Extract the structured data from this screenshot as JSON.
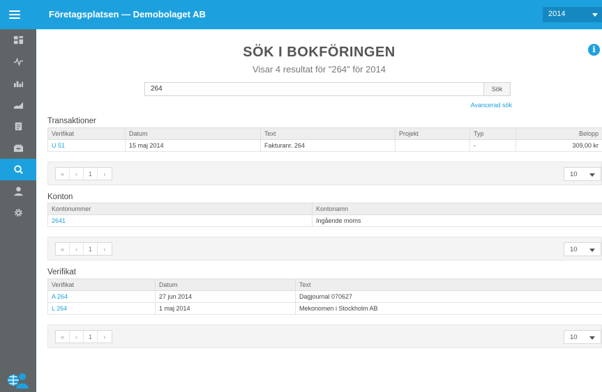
{
  "header": {
    "app_title": "Företagsplatsen — Demobolaget AB",
    "year": "2014"
  },
  "sidebar": {
    "items": [
      {
        "icon": "dashboard-icon",
        "active": false
      },
      {
        "icon": "pulse-icon",
        "active": false
      },
      {
        "icon": "bar-chart-icon",
        "active": false
      },
      {
        "icon": "area-chart-icon",
        "active": false
      },
      {
        "icon": "document-icon",
        "active": false
      },
      {
        "icon": "inbox-icon",
        "active": false
      },
      {
        "icon": "search-icon",
        "active": true
      },
      {
        "icon": "user-icon",
        "active": false
      },
      {
        "icon": "gear-icon",
        "active": false
      }
    ],
    "bottom_icon": "support-icon"
  },
  "page": {
    "title": "SÖK I BOKFÖRINGEN",
    "subtitle": "Visar 4 resultat för \"264\" för 2014"
  },
  "search": {
    "value": "264",
    "button_label": "Sök",
    "advanced_link": "Avancerad sök"
  },
  "transactions": {
    "title": "Transaktioner",
    "columns": [
      "Verifikat",
      "Datum",
      "Text",
      "Projekt",
      "Typ",
      "Belopp"
    ],
    "rows": [
      {
        "verifikat": "U 51",
        "datum": "15 maj 2014",
        "text": "Fakturanr. 264",
        "projekt": "",
        "typ": "-",
        "belopp": "309,00 kr"
      }
    ]
  },
  "accounts": {
    "title": "Konton",
    "columns": [
      "Kontonummer",
      "Kontonamn"
    ],
    "rows": [
      {
        "kontonummer": "2641",
        "kontonamn": "Ingående moms"
      }
    ]
  },
  "vouchers": {
    "title": "Verifikat",
    "columns": [
      "Verifikat",
      "Datum",
      "Text"
    ],
    "rows": [
      {
        "verifikat": "A 264",
        "datum": "27 jun 2014",
        "text": "Dagjournal 070627"
      },
      {
        "verifikat": "L 264",
        "datum": "1 maj 2014",
        "text": "Mekonomen i Stockholm AB"
      }
    ]
  },
  "pagination": {
    "first": "«",
    "prev": "‹",
    "page": "1",
    "next": "›",
    "page_size": "10"
  },
  "colors": {
    "accent": "#1da1de",
    "sidebar": "#5f6467"
  }
}
